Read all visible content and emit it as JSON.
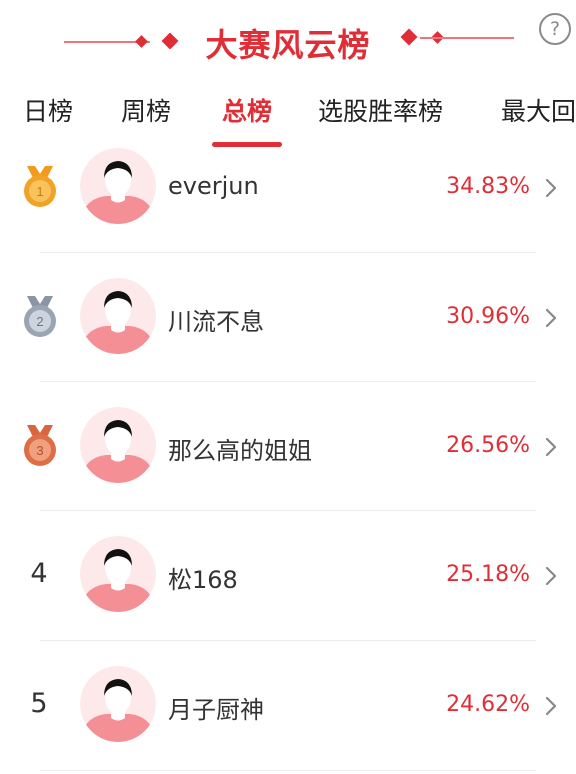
{
  "header": {
    "title": "大赛风云榜",
    "help_icon": "?",
    "accent_color": "#e02e36"
  },
  "tabs": [
    {
      "label": "日榜",
      "active": false
    },
    {
      "label": "周榜",
      "active": false
    },
    {
      "label": "总榜",
      "active": true
    },
    {
      "label": "选股胜率榜",
      "active": false
    },
    {
      "label": "最大回",
      "active": false
    }
  ],
  "ranking": [
    {
      "rank": "1",
      "badge": "gold-medal-icon",
      "name": "everjun",
      "rate": "34.83%"
    },
    {
      "rank": "2",
      "badge": "silver-medal-icon",
      "name": "川流不息",
      "rate": "30.96%"
    },
    {
      "rank": "3",
      "badge": "bronze-medal-icon",
      "name": "那么高的姐姐",
      "rate": "26.56%"
    },
    {
      "rank": "4",
      "badge": "",
      "name": "松168",
      "rate": "25.18%"
    },
    {
      "rank": "5",
      "badge": "",
      "name": "月子厨神",
      "rate": "24.62%"
    }
  ]
}
